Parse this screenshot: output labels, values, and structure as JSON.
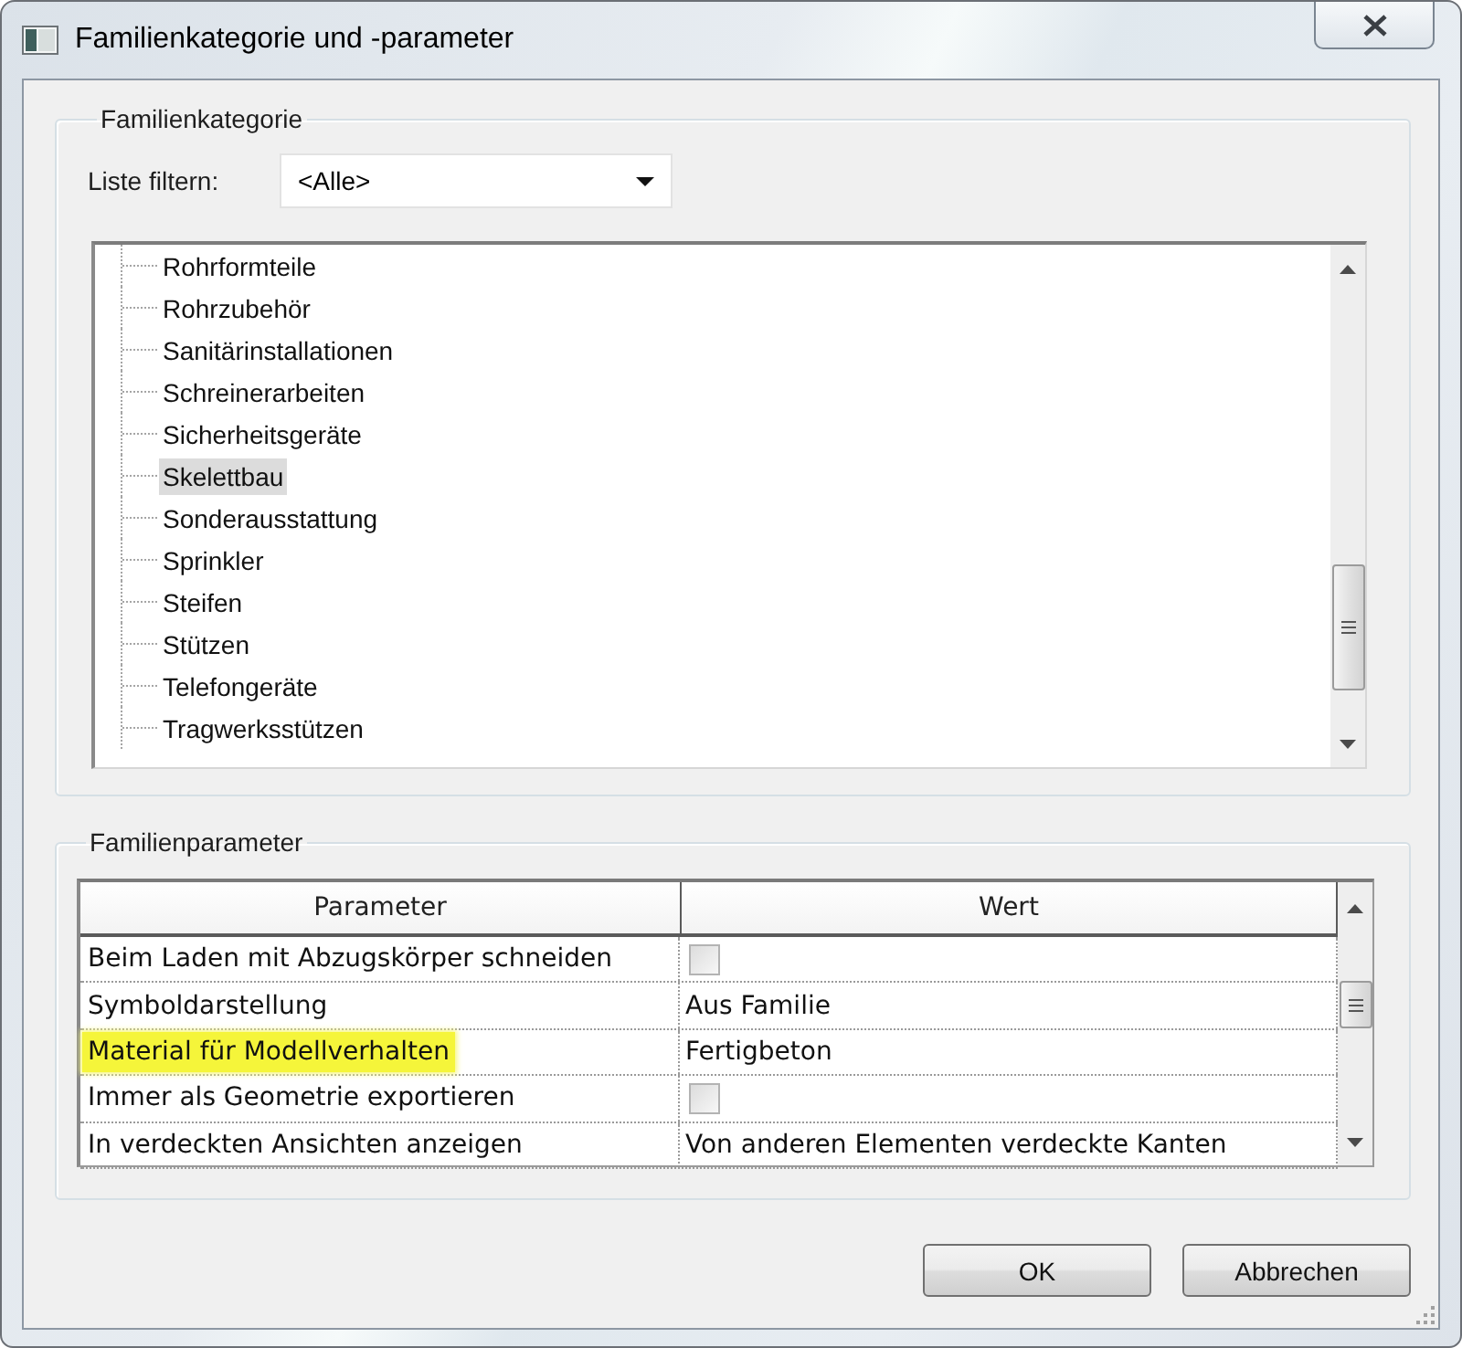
{
  "window": {
    "title": "Familienkategorie und -parameter"
  },
  "category_group": {
    "title": "Familienkategorie",
    "filter": {
      "label": "Liste filtern:",
      "value": "<Alle>"
    },
    "tree": {
      "items": [
        {
          "label": "Rohrformteile",
          "selected": false
        },
        {
          "label": "Rohrzubehör",
          "selected": false
        },
        {
          "label": "Sanitärinstallationen",
          "selected": false
        },
        {
          "label": "Schreinerarbeiten",
          "selected": false
        },
        {
          "label": "Sicherheitsgeräte",
          "selected": false
        },
        {
          "label": "Skelettbau",
          "selected": true
        },
        {
          "label": "Sonderausstattung",
          "selected": false
        },
        {
          "label": "Sprinkler",
          "selected": false
        },
        {
          "label": "Steifen",
          "selected": false
        },
        {
          "label": "Stützen",
          "selected": false
        },
        {
          "label": "Telefongeräte",
          "selected": false
        },
        {
          "label": "Tragwerksstützen",
          "selected": false
        }
      ]
    }
  },
  "parameter_group": {
    "title": "Familienparameter",
    "table": {
      "columns": [
        "Parameter",
        "Wert"
      ],
      "rows": [
        {
          "parameter": "Beim Laden mit Abzugskörper schneiden",
          "highlighted": false,
          "value": {
            "kind": "checkbox",
            "checked": false
          }
        },
        {
          "parameter": "Symboldarstellung",
          "highlighted": false,
          "value": {
            "kind": "text",
            "text": "Aus Familie"
          }
        },
        {
          "parameter": "Material für Modellverhalten",
          "highlighted": true,
          "value": {
            "kind": "text",
            "text": "Fertigbeton"
          }
        },
        {
          "parameter": "Immer als Geometrie exportieren",
          "highlighted": false,
          "value": {
            "kind": "checkbox",
            "checked": false
          }
        },
        {
          "parameter": "In verdeckten Ansichten anzeigen",
          "highlighted": false,
          "value": {
            "kind": "text",
            "text": "Von anderen Elementen verdeckte Kanten"
          }
        }
      ]
    }
  },
  "buttons": [
    {
      "label": "OK"
    },
    {
      "label": "Abbrechen"
    }
  ]
}
